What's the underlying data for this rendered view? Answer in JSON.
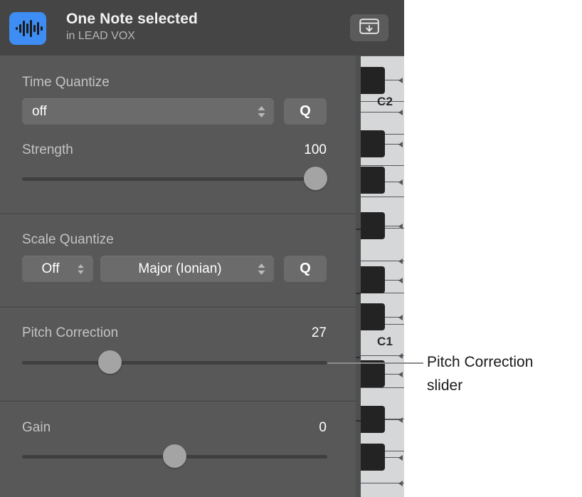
{
  "header": {
    "icon": "audio-waveform-icon",
    "title": "One Note selected",
    "subtitle": "in LEAD VOX",
    "hide_button_icon": "hide-inspector-icon"
  },
  "sections": {
    "time_quantize": {
      "label": "Time Quantize",
      "popup_value": "off",
      "q_button": "Q",
      "strength": {
        "label": "Strength",
        "value": "100",
        "percent": 100
      }
    },
    "scale_quantize": {
      "label": "Scale Quantize",
      "root_value": "Off",
      "scale_value": "Major (Ionian)",
      "q_button": "Q"
    },
    "pitch_correction": {
      "label": "Pitch Correction",
      "value": "27",
      "percent": 27
    },
    "gain": {
      "label": "Gain",
      "value": "0",
      "percent": 50
    }
  },
  "piano": {
    "octave_labels": [
      "C2",
      "C1"
    ]
  },
  "annotation": {
    "callout": "Pitch Correction\nslider"
  },
  "colors": {
    "accent": "#3d8df5",
    "header_bg": "#454545",
    "panel_bg": "#585858",
    "control_bg": "#6b6b6b",
    "track": "#3f3f3f",
    "thumb": "#a4a4a4",
    "white_key": "#d6d7d9",
    "black_key": "#232323"
  }
}
